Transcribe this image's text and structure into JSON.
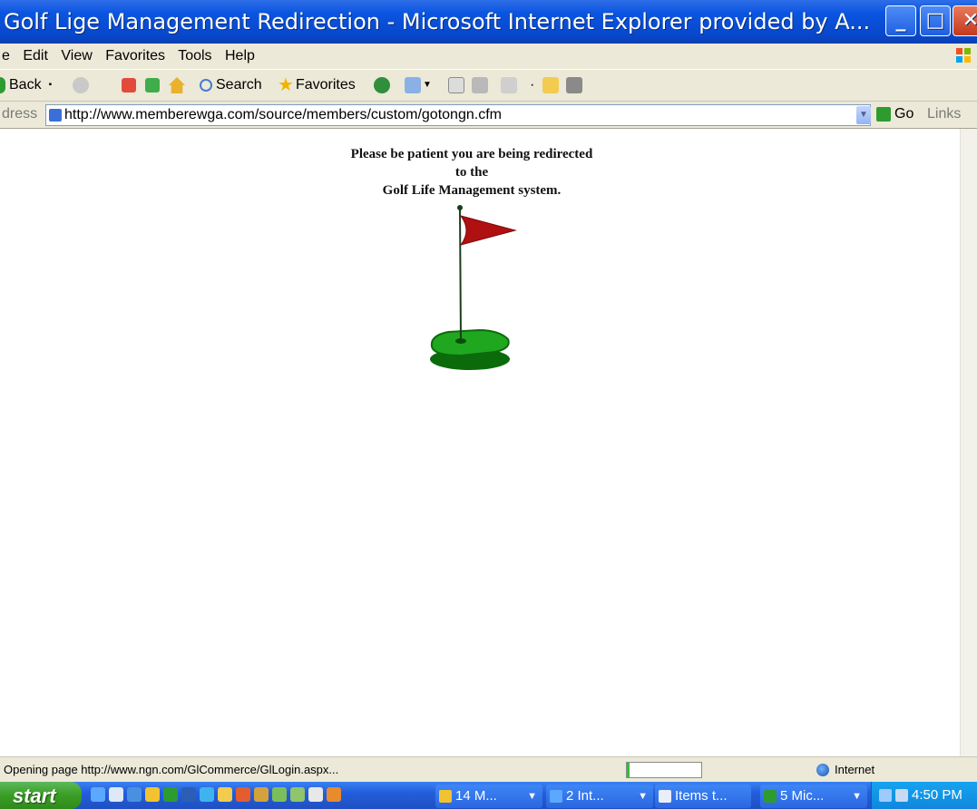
{
  "window": {
    "title": "Golf Lige Management Redirection - Microsoft Internet Explorer provided by A...",
    "minimize_icon": "minimize-icon",
    "maximize_icon": "maximize-icon",
    "close_icon": "close-icon"
  },
  "menu": {
    "items": [
      "e",
      "Edit",
      "View",
      "Favorites",
      "Tools",
      "Help"
    ]
  },
  "toolbar": {
    "back_label": "Back",
    "search_label": "Search",
    "favorites_label": "Favorites"
  },
  "address": {
    "label": "dress",
    "url": "http://www.memberewga.com/source/members/custom/gotongn.cfm",
    "go_label": "Go",
    "links_label": "Links"
  },
  "page": {
    "line1": "Please be patient you are being redirected",
    "line2": "to the",
    "line3": "Golf Life Management system.",
    "flag_color": "#b01010",
    "green_color": "#1fa81f"
  },
  "status": {
    "text": "Opening page http://www.ngn.com/GlCommerce/GlLogin.aspx...",
    "progress_fraction": 0.04,
    "zone": "Internet"
  },
  "taskbar": {
    "start_label": "start",
    "tasks": [
      {
        "label": "14 M...",
        "has_arrow": true
      },
      {
        "label": "2 Int...",
        "has_arrow": true
      },
      {
        "label": "Items t...",
        "has_arrow": false
      },
      {
        "label": "5 Mic...",
        "has_arrow": true
      }
    ],
    "clock": "4:50 PM"
  }
}
